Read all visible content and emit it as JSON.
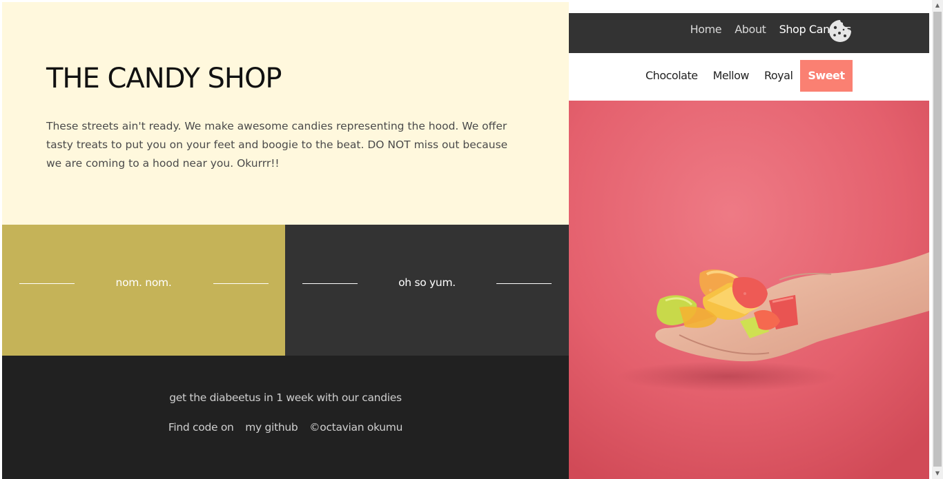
{
  "hero": {
    "title": "THE CANDY SHOP",
    "description": "These streets ain't ready. We make awesome candies representing the hood. We offer tasty treats to put you on your feet and boogie to the beat. DO NOT miss out because we are coming to a hood near you. Okurrr!!"
  },
  "tiles": [
    {
      "label": "nom. nom.",
      "color": "#c5b358"
    },
    {
      "label": "oh so yum.",
      "color": "#333333"
    }
  ],
  "footer": {
    "tagline": "get the diabeetus in 1 week with our candies",
    "find_code": "Find code on",
    "github": "my github",
    "copyright": "©octavian okumu"
  },
  "nav": {
    "items": [
      "Home",
      "About",
      "Shop Candies"
    ],
    "active": "Shop Candies",
    "icon": "cookie-icon"
  },
  "categories": {
    "items": [
      "Chocolate",
      "Mellow",
      "Royal",
      "Sweet"
    ],
    "selected": "Sweet",
    "accent": "#fa8072"
  },
  "colors": {
    "hero_bg": "#fff8dd",
    "footer_bg": "#212121",
    "topbar_bg": "#333333",
    "photo_bg": "#e35d6a"
  }
}
